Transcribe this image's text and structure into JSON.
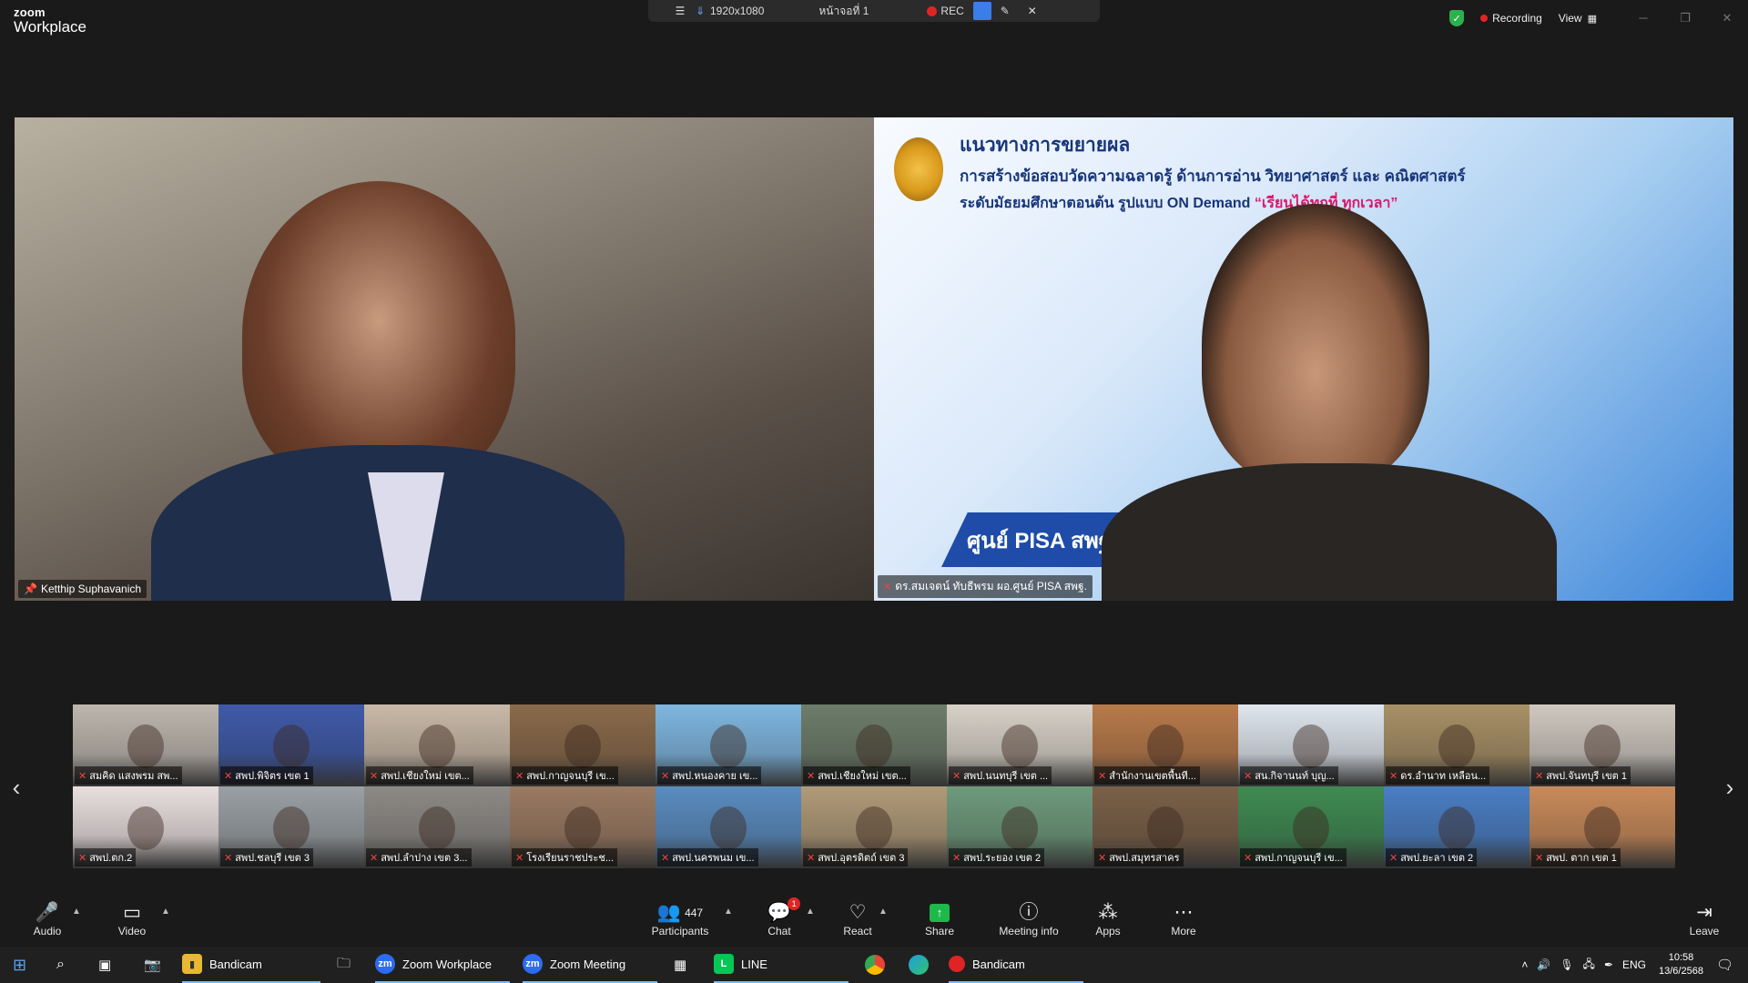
{
  "window": {
    "brand_top": "zoom",
    "brand_bottom": "Workplace"
  },
  "bandicam_bar": {
    "resolution": "1920x1080",
    "page": "หน้าจอที่ 1",
    "rec_label": "REC"
  },
  "top_right": {
    "recording": "Recording",
    "view": "View"
  },
  "speakers": [
    {
      "name": "Ketthip Suphavanich"
    },
    {
      "name": "ดร.สมเจตน์ ทับธีพรม ผอ.ศูนย์ PISA สพฐ."
    }
  ],
  "slide": {
    "title1": "แนวทางการขยายผล",
    "title2": "การสร้างข้อสอบวัดความฉลาดรู้ ด้านการอ่าน วิทยาศาสตร์ และ คณิตศาสตร์",
    "title3": "ระดับมัธยมศึกษาตอนต้น รูปแบบ ON Demand",
    "highlight": "“เรียนได้ทุกที่ ทุกเวลา”",
    "banner": "ศูนย์ PISA สพฐ"
  },
  "gallery": [
    {
      "name": "สมคิด แสงพรม สพ...",
      "color": "#bdb6ae"
    },
    {
      "name": "สพป.พิจิตร เขต 1",
      "color": "#3f5aa8"
    },
    {
      "name": "สพป.เชียงใหม่ เขต...",
      "color": "#c9b9a8"
    },
    {
      "name": "สพป.กาญจนบุรี เข...",
      "color": "#8a6a4a"
    },
    {
      "name": "สพป.หนองคาย เข...",
      "color": "#7fb6e0"
    },
    {
      "name": "สพป.เชียงใหม่ เขต...",
      "color": "#6d7d6a"
    },
    {
      "name": "สพป.นนทบุรี เขต ...",
      "color": "#d8d2c8"
    },
    {
      "name": "สำนักงานเขตพื้นที...",
      "color": "#b87a4a"
    },
    {
      "name": "สน.กิจานนท์ บุญ...",
      "color": "#dfe6ee"
    },
    {
      "name": "ดร.อำนาท เหลือน...",
      "color": "#a89066"
    },
    {
      "name": "สพป.จันทบุรี เขต 1",
      "color": "#cfc8c0"
    },
    {
      "name": "สพป.ตก.2",
      "color": "#e8dede"
    },
    {
      "name": "สพป.ชลบุรี เขต 3",
      "color": "#9aa0a4"
    },
    {
      "name": "สพป.ลำปาง เขต 3...",
      "color": "#8d8a86"
    },
    {
      "name": "โรงเรียนราชประช...",
      "color": "#9a7a62"
    },
    {
      "name": "สพป.นครพนม เข...",
      "color": "#5a8cc0"
    },
    {
      "name": "สพป.อุตรดิตถ์ เขต 3",
      "color": "#b09a78"
    },
    {
      "name": "สพป.ระยอง เขต 2",
      "color": "#6e9a7c"
    },
    {
      "name": "สพป.สมุทรสาคร",
      "color": "#7a6048"
    },
    {
      "name": "สพป.กาญจนบุรี เข...",
      "color": "#3f8a52"
    },
    {
      "name": "สพป.ยะลา เขต 2",
      "color": "#4a7ec4"
    },
    {
      "name": "สพป. ตาก เขต 1",
      "color": "#c88a5a"
    }
  ],
  "toolbar": {
    "audio": "Audio",
    "video": "Video",
    "participants": "Participants",
    "participants_count": "447",
    "chat": "Chat",
    "chat_badge": "1",
    "react": "React",
    "share": "Share",
    "meeting_info": "Meeting info",
    "apps": "Apps",
    "more": "More",
    "leave": "Leave"
  },
  "taskbar": {
    "items": [
      "Bandicam",
      "Zoom Workplace",
      "Zoom Meeting",
      "LINE",
      "Bandicam"
    ],
    "lang": "ENG",
    "time": "10:58",
    "date": "13/6/2568"
  }
}
